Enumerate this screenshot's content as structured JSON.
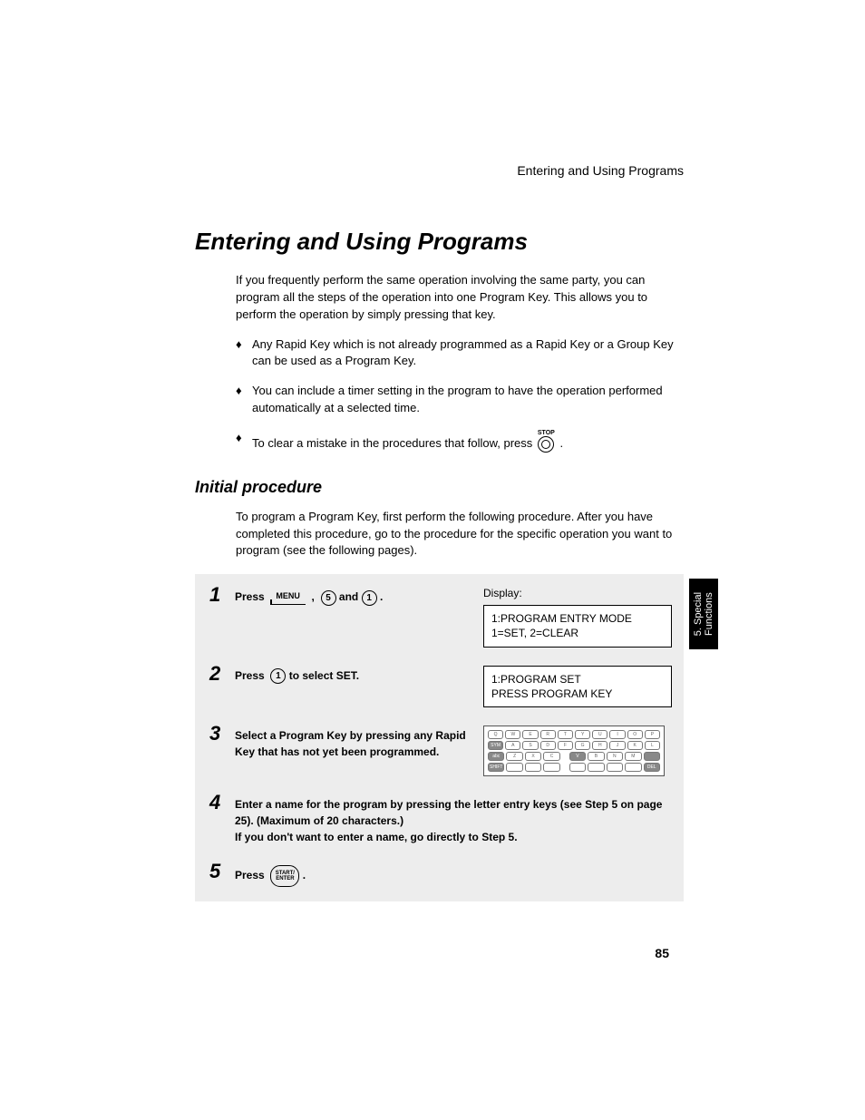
{
  "runningHeader": "Entering and Using Programs",
  "title": "Entering and Using Programs",
  "intro": "If you frequently perform the same operation involving the same party, you can program all the steps of the operation into one Program Key. This allows you to perform the operation by simply pressing that key.",
  "bullets": [
    "Any Rapid Key which is not already programmed as a Rapid Key or a Group Key can be used as a Program Key.",
    "You can include a timer setting in the program to have the operation performed automatically at a selected time.",
    "To clear a mistake in the procedures that follow, press"
  ],
  "stopLabel": "STOP",
  "subheading": "Initial procedure",
  "subintro": "To program a Program Key, first perform the following procedure. After you have completed this procedure, go to the procedure for the specific operation you want to program (see the following pages).",
  "steps": {
    "s1": {
      "num": "1",
      "pressWord": "Press",
      "menuLabel": "MENU",
      "sep": ",",
      "key1": "5",
      "andWord": "and",
      "key2": "1",
      "period": ".",
      "displayLabel": "Display:",
      "displayLine1": "1:PROGRAM ENTRY MODE",
      "displayLine2": "1=SET, 2=CLEAR"
    },
    "s2": {
      "num": "2",
      "pressWord": "Press",
      "key": "1",
      "rest": "to select SET.",
      "displayLine1": "1:PROGRAM SET",
      "displayLine2": "PRESS PROGRAM KEY"
    },
    "s3": {
      "num": "3",
      "text": "Select a Program Key by pressing any Rapid Key that has not yet been programmed."
    },
    "s4": {
      "num": "4",
      "line1": "Enter a name for the program by pressing the letter entry keys (see Step 5 on page 25). (Maximum of 20 characters.)",
      "line2": "If you don't want to enter a name, go directly to Step 5."
    },
    "s5": {
      "num": "5",
      "pressWord": "Press",
      "enterLine1": "START/",
      "enterLine2": "ENTER",
      "period": "."
    }
  },
  "sideTab": {
    "line1": "5. Special",
    "line2": "Functions"
  },
  "pageNumber": "85"
}
